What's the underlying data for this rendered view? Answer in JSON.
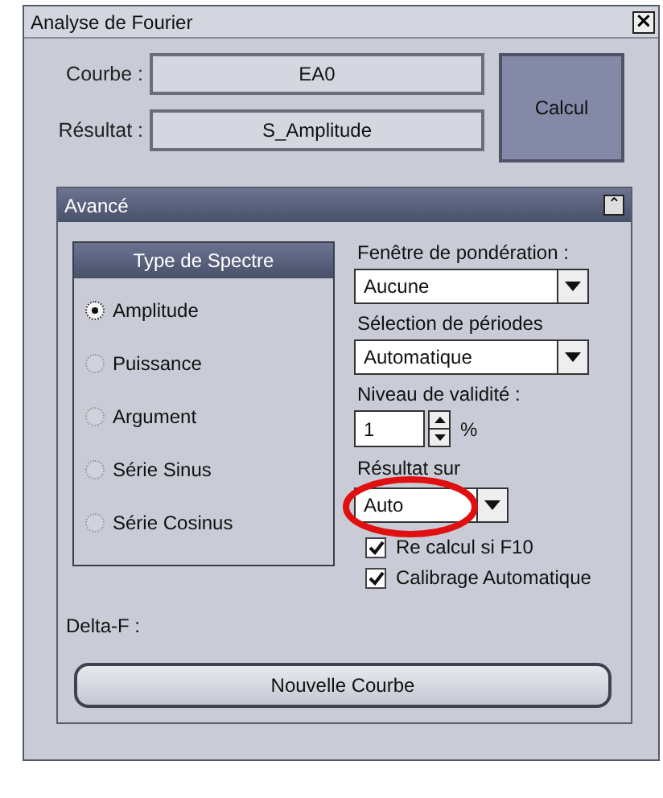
{
  "window": {
    "title": "Analyse de Fourier",
    "close": "×"
  },
  "fields": [
    {
      "label": "Courbe :",
      "value": "EA0"
    },
    {
      "label": "Résultat :",
      "value": "S_Amplitude"
    }
  ],
  "calc_button": "Calcul",
  "panel": {
    "title": "Avancé",
    "collapse": "⌃",
    "spectrum": {
      "title": "Type de Spectre",
      "options": [
        {
          "label": "Amplitude",
          "selected": true
        },
        {
          "label": "Puissance",
          "selected": false
        },
        {
          "label": "Argument",
          "selected": false
        },
        {
          "label": "Série Sinus",
          "selected": false
        },
        {
          "label": "Série Cosinus",
          "selected": false
        }
      ]
    },
    "controls": [
      {
        "kind": "select",
        "label": "Fenêtre de pondération :",
        "value": "Aucune"
      },
      {
        "kind": "select",
        "label": "Sélection de périodes",
        "value": "Automatique"
      },
      {
        "kind": "spin",
        "label": "Niveau de validité :",
        "value": "1",
        "unit": "%"
      },
      {
        "kind": "small-select",
        "label": "Résultat sur",
        "value": "Auto",
        "highlighted": true
      }
    ],
    "checkboxes": [
      {
        "label": "Re calcul si F10",
        "checked": true
      },
      {
        "label": "Calibrage Automatique",
        "checked": true
      }
    ],
    "delta_label": "Delta-F :",
    "new_button": "Nouvelle Courbe"
  }
}
